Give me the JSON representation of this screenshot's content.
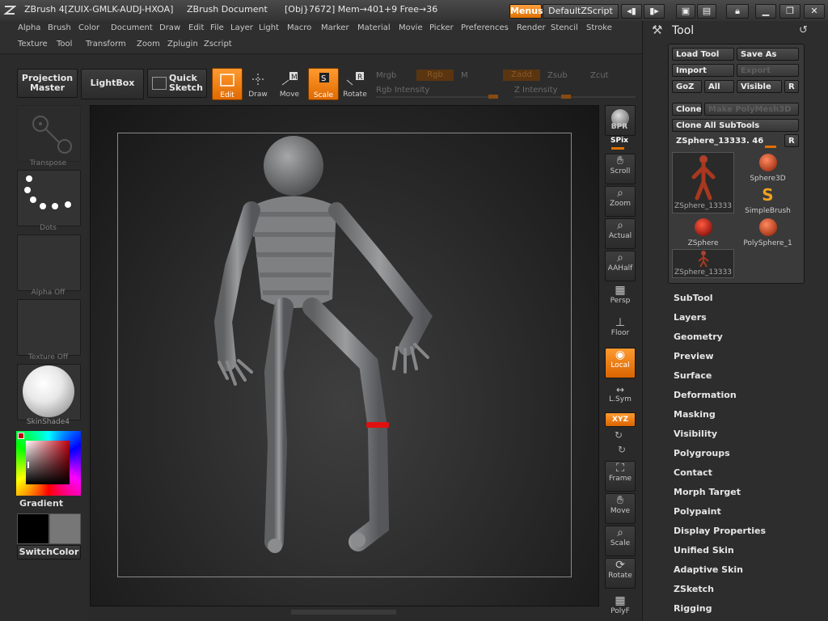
{
  "title": {
    "app": "ZBrush 4[ZUIX-GMLK-AUDJ-HXOA]",
    "doc": "ZBrush Document",
    "stats": "[Obj}7672] Mem→401+9 Free→36",
    "menus_btn": "Menus",
    "script_btn": "DefaultZScript"
  },
  "menubar": {
    "row1": [
      "Alpha",
      "Brush",
      "Color",
      "Document",
      "Draw",
      "Edit",
      "File",
      "Layer",
      "Light",
      "Macro",
      "Marker",
      "Material",
      "Movie",
      "Picker",
      "Preferences",
      "Render",
      "Stencil",
      "Stroke"
    ],
    "row2": [
      "Texture",
      "Tool",
      "Transform",
      "Zoom",
      "Zplugin",
      "Zscript"
    ]
  },
  "shelf": {
    "projection_master": [
      "Projection",
      "Master"
    ],
    "lightbox": "LightBox",
    "quick_sketch": [
      "Quick",
      "Sketch"
    ],
    "tools": [
      "Edit",
      "Draw",
      "Move",
      "Scale",
      "Rotate"
    ],
    "mrgb": "Mrgb",
    "rgb": "Rgb",
    "m": "M",
    "zadd": "Zadd",
    "zsub": "Zsub",
    "zcut": "Zcut",
    "rgb_intensity": "Rgb Intensity",
    "z_intensity": "Z Intensity"
  },
  "left_tray": {
    "transpose": "Transpose",
    "dots": "Dots",
    "alpha_off": "Alpha Off",
    "texture_off": "Texture Off",
    "material": "SkinShade4",
    "gradient": "Gradient",
    "switch_color": "SwitchColor"
  },
  "right_tools": {
    "bpr": "BPR",
    "spix": "SPix",
    "buttons": [
      "Scroll",
      "Zoom",
      "Actual",
      "AAHalf",
      "Persp",
      "Floor",
      "Local",
      "L.Sym",
      "XYZ",
      "Frame",
      "Move",
      "Scale",
      "Rotate",
      "PolyF"
    ]
  },
  "tool_panel": {
    "header": "Tool",
    "load_tool": "Load Tool",
    "save_as": "Save As",
    "import": "Import",
    "export": "Export",
    "goz": "GoZ",
    "all": "All",
    "visible": "Visible",
    "r": "R",
    "clone": "Clone",
    "make_polymesh": "Make PolyMesh3D",
    "clone_all": "Clone All SubTools",
    "current_tool": "ZSphere_13333. 46",
    "items": [
      "ZSphere_13333",
      "Sphere3D",
      "SimpleBrush",
      "ZSphere",
      "PolySphere_1",
      "ZSphere_13333"
    ],
    "subpalettes": [
      "SubTool",
      "Layers",
      "Geometry",
      "Preview",
      "Surface",
      "Deformation",
      "Masking",
      "Visibility",
      "Polygroups",
      "Contact",
      "Morph Target",
      "Polypaint",
      "Display Properties",
      "Unified Skin",
      "Adaptive Skin",
      "ZSketch",
      "Rigging"
    ]
  },
  "colors": {
    "accent": "#f08a1c",
    "panel": "#2d2d2d",
    "canvas": "#2e2e2e",
    "model": "#8a8c8e",
    "ring": "#e01010"
  }
}
